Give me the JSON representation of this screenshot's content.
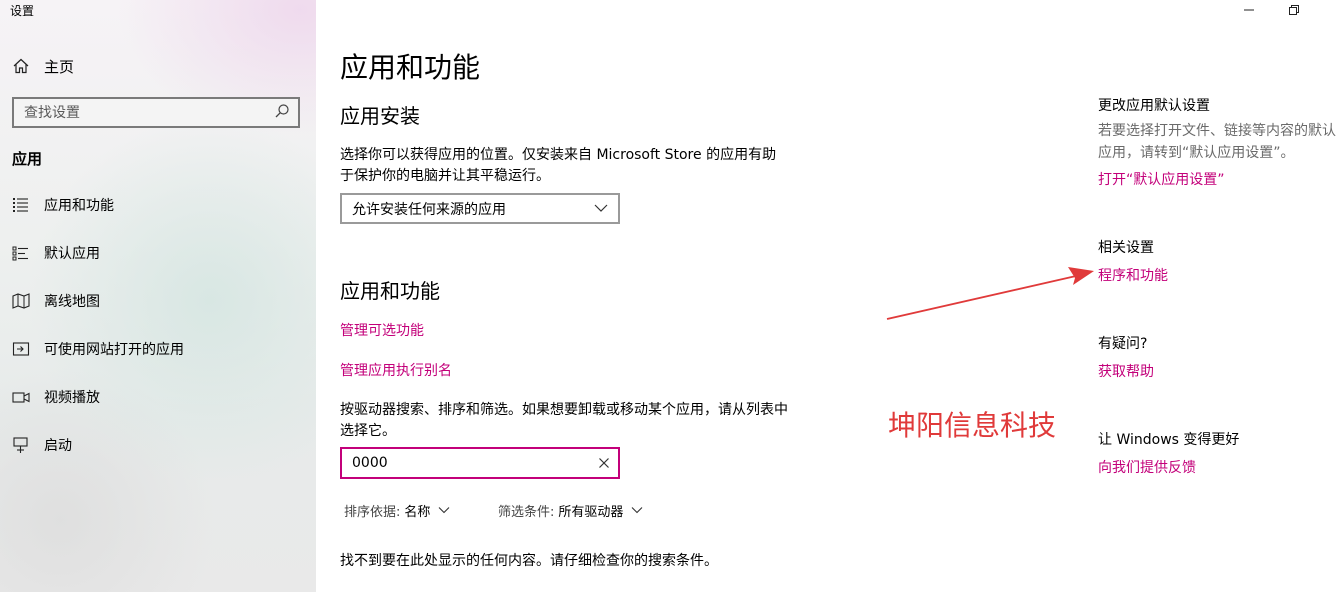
{
  "window": {
    "title": "设置",
    "controls": {
      "minimize_icon": "minimize-icon",
      "restore_icon": "restore-icon"
    }
  },
  "sidebar": {
    "home_label": "主页",
    "search_placeholder": "查找设置",
    "section_label": "应用",
    "items": [
      {
        "label": "应用和功能",
        "icon": "apps-features-icon"
      },
      {
        "label": "默认应用",
        "icon": "default-apps-icon"
      },
      {
        "label": "离线地图",
        "icon": "offline-maps-icon"
      },
      {
        "label": "可使用网站打开的应用",
        "icon": "apps-for-websites-icon"
      },
      {
        "label": "视频播放",
        "icon": "video-playback-icon"
      },
      {
        "label": "启动",
        "icon": "startup-icon"
      }
    ]
  },
  "main": {
    "title": "应用和功能",
    "install": {
      "heading": "应用安装",
      "description": "选择你可以获得应用的位置。仅安装来自 Microsoft Store 的应用有助于保护你的电脑并让其平稳运行。",
      "dropdown_value": "允许安装任何来源的应用"
    },
    "apps": {
      "heading": "应用和功能",
      "link_optional": "管理可选功能",
      "link_alias": "管理应用执行别名",
      "description": "按驱动器搜索、排序和筛选。如果想要卸载或移动某个应用，请从列表中选择它。",
      "search_value": "0000",
      "sort_label": "排序依据:",
      "sort_value": "名称",
      "filter_label": "筛选条件:",
      "filter_value": "所有驱动器",
      "empty_message": "找不到要在此处显示的任何内容。请仔细检查你的搜索条件。"
    }
  },
  "right": {
    "defaults": {
      "heading": "更改应用默认设置",
      "text": "若要选择打开文件、链接等内容的默认应用，请转到“默认应用设置”。",
      "link": "打开“默认应用设置”"
    },
    "related": {
      "heading": "相关设置",
      "link": "程序和功能"
    },
    "help": {
      "heading": "有疑问?",
      "link": "获取帮助"
    },
    "feedback": {
      "heading": "让 Windows 变得更好",
      "link": "向我们提供反馈"
    }
  },
  "annotation": {
    "watermark_text": "坤阳信息科技",
    "arrow_color": "#e03a3a"
  },
  "colors": {
    "accent": "#c3007a",
    "annotation": "#e03a3a"
  }
}
